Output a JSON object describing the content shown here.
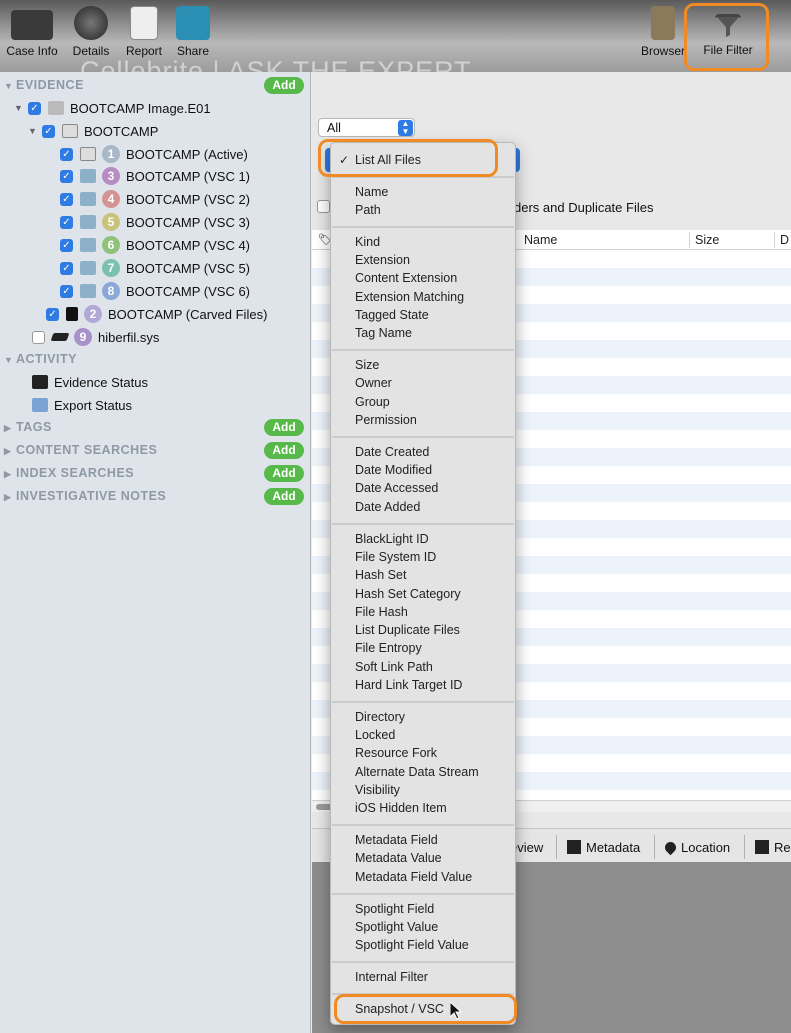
{
  "toolbar": {
    "buttons": [
      {
        "label": "Case Info",
        "icon": "briefcase-icon"
      },
      {
        "label": "Details",
        "icon": "gauge-icon"
      },
      {
        "label": "Report",
        "icon": "report-icon"
      },
      {
        "label": "Share",
        "icon": "folder-share-icon"
      }
    ],
    "right_buttons": [
      {
        "label": "Browser",
        "icon": "browser-icon"
      },
      {
        "label": "File Filter",
        "icon": "funnel-icon"
      }
    ],
    "watermark": "Cellebrite  |  ASK THE EXPERT"
  },
  "sidebar": {
    "sections": [
      {
        "label": "EVIDENCE",
        "has_add": true
      },
      {
        "label": "ACTIVITY",
        "has_add": false
      },
      {
        "label": "TAGS",
        "has_add": true
      },
      {
        "label": "CONTENT SEARCHES",
        "has_add": true
      },
      {
        "label": "INDEX SEARCHES",
        "has_add": true
      },
      {
        "label": "INVESTIGATIVE NOTES",
        "has_add": true
      }
    ],
    "add_label": "Add",
    "evidence_tree": [
      {
        "label": "BOOTCAMP Image.E01",
        "checked": true,
        "number": ""
      },
      {
        "label": "BOOTCAMP",
        "checked": true,
        "number": ""
      },
      {
        "label": "BOOTCAMP (Active)",
        "checked": true,
        "number": "1"
      },
      {
        "label": "BOOTCAMP (VSC 1)",
        "checked": true,
        "number": "3"
      },
      {
        "label": "BOOTCAMP (VSC 2)",
        "checked": true,
        "number": "4"
      },
      {
        "label": "BOOTCAMP (VSC 3)",
        "checked": true,
        "number": "5"
      },
      {
        "label": "BOOTCAMP (VSC 4)",
        "checked": true,
        "number": "6"
      },
      {
        "label": "BOOTCAMP (VSC 5)",
        "checked": true,
        "number": "7"
      },
      {
        "label": "BOOTCAMP (VSC 6)",
        "checked": true,
        "number": "8"
      },
      {
        "label": "BOOTCAMP (Carved Files)",
        "checked": true,
        "number": "2"
      },
      {
        "label": "hiberfil.sys",
        "checked": false,
        "number": "9"
      }
    ],
    "activity_items": [
      {
        "label": "Evidence Status"
      },
      {
        "label": "Export Status"
      }
    ]
  },
  "main": {
    "scope_select": "All",
    "filter_text": "ders and Duplicate Files",
    "columns": [
      "Name",
      "Size",
      "D"
    ],
    "tabs": [
      "eview",
      "Metadata",
      "Location",
      "Re"
    ]
  },
  "menu": {
    "selected": "List All Files",
    "groups": [
      [
        "Name",
        "Path"
      ],
      [
        "Kind",
        "Extension",
        "Content Extension",
        "Extension Matching",
        "Tagged State",
        "Tag Name"
      ],
      [
        "Size",
        "Owner",
        "Group",
        "Permission"
      ],
      [
        "Date Created",
        "Date Modified",
        "Date Accessed",
        "Date Added"
      ],
      [
        "BlackLight ID",
        "File System ID",
        "Hash Set",
        "Hash Set Category",
        "File Hash",
        "List Duplicate Files",
        "File Entropy",
        "Soft Link Path",
        "Hard Link Target ID"
      ],
      [
        "Directory",
        "Locked",
        "Resource Fork",
        "Alternate Data Stream",
        "Visibility",
        "iOS Hidden Item"
      ],
      [
        "Metadata Field",
        "Metadata Value",
        "Metadata Field Value"
      ],
      [
        "Spotlight Field",
        "Spotlight Value",
        "Spotlight Field Value"
      ],
      [
        "Internal Filter"
      ],
      [
        "Snapshot / VSC"
      ]
    ]
  },
  "colors": {
    "accent": "#2d7be3",
    "highlight": "#f08a24",
    "add_green": "#58b94b"
  }
}
